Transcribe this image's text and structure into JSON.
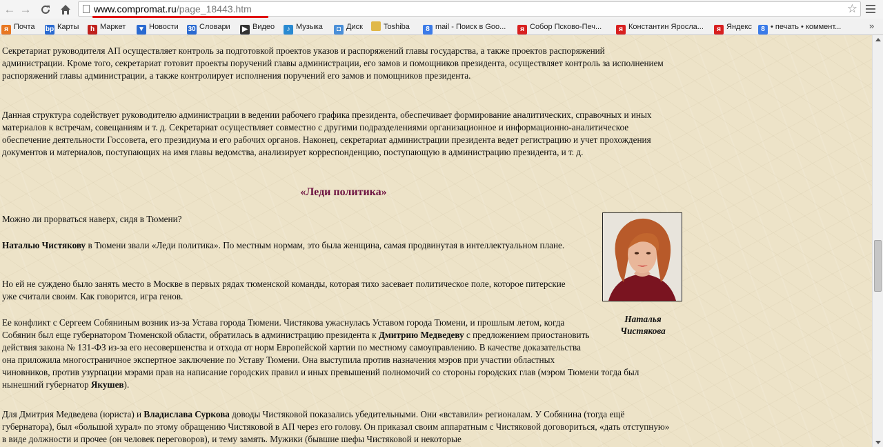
{
  "browser": {
    "url_host": "www.compromat.ru",
    "url_path": "/page_18443.htm",
    "icons": [
      "back-arrow-icon",
      "forward-arrow-icon",
      "reload-icon",
      "home-icon",
      "page-icon",
      "bookmark-star-icon",
      "menu-icon"
    ]
  },
  "bookmarks": [
    {
      "label": "Почта",
      "icon": "mail-icon",
      "color": "#e87722",
      "glyph": "я"
    },
    {
      "label": "Карты",
      "icon": "maps-icon",
      "color": "#2a6ad1",
      "glyph": "bp"
    },
    {
      "label": "Маркет",
      "icon": "market-icon",
      "color": "#c0201c",
      "glyph": "h"
    },
    {
      "label": "Новости",
      "icon": "news-icon",
      "color": "#2a6ad1",
      "glyph": "▼"
    },
    {
      "label": "Словари",
      "icon": "dictionary-icon",
      "color": "#2a6ad1",
      "glyph": "30"
    },
    {
      "label": "Видео",
      "icon": "video-icon",
      "color": "#333333",
      "glyph": "▶"
    },
    {
      "label": "Музыка",
      "icon": "music-icon",
      "color": "#2a8ad1",
      "glyph": "♪"
    },
    {
      "label": "Диск",
      "icon": "disk-icon",
      "color": "#4a8fd8",
      "glyph": "◘"
    },
    {
      "label": "Toshiba",
      "icon": "folder-icon",
      "color": "#e0b84a",
      "glyph": ""
    },
    {
      "label": "mail - Поиск в Goo...",
      "icon": "google-icon",
      "color": "#3b7be8",
      "glyph": "8"
    },
    {
      "label": "Собор Псково-Печ...",
      "icon": "yandex-icon",
      "color": "#d82020",
      "glyph": "я"
    },
    {
      "label": "Константин Яросла...",
      "icon": "yandex-icon",
      "color": "#d82020",
      "glyph": "я"
    },
    {
      "label": "Яндекс",
      "icon": "yandex-icon",
      "color": "#d82020",
      "glyph": "я"
    },
    {
      "label": "• печать • коммент...",
      "icon": "google-icon",
      "color": "#3b7be8",
      "glyph": "8"
    }
  ],
  "bookmarks_more": "»",
  "article": {
    "p1": "Секретариат руководителя АП осуществляет контроль за подготовкой проектов указов и распоряжений главы государства, а также проектов распоряжений администрации. Кроме того, секретариат готовит проекты поручений главы администрации, его замов и помощников президента, осуществляет контроль за исполнением распоряжений главы администрации, а также контролирует исполнения поручений его замов и помощников президента.",
    "p2": "Данная структура содействует руководителю администрации в ведении рабочего графика президента, обеспечивает формирование аналитических, справочных и иных материалов к встречам, совещаниям и т. д. Секретариат осуществляет совместно с другими подразделениями организационное и информационно-аналитическое обеспечение деятельности Госсовета, его президиума и его рабочих органов. Наконец, секретариат администрации президента ведет регистрацию и учет прохождения документов и материалов, поступающих на имя главы ведомства, анализирует корреспонденцию, поступающую в администрацию президента, и т. д.",
    "heading": "«Леди политика»",
    "p3": "Можно ли прорваться наверх, сидя в Тюмени?",
    "p4_bold": "Наталью Чистякову",
    "p4_rest": " в Тюмени звали «Леди политика». По местным нормам, это была женщина, самая продвинутая в интеллектуальном плане.",
    "p5": "Но ей не суждено было занять место в Москве в первых рядах тюменской команды, которая тихо засевает политическое поле, которое питерские уже считали своим. Как говорится, игра генов.",
    "p6_a": "Ее конфликт с Сергеем Собяниным возник из-за Устава города Тюмени. Чистякова ужаснулась Уставом города Тюмени, и прошлым летом, когда Собянин был еще губернатором Тюменской области, обратилась в администрацию президента к ",
    "p6_bold1": "Дмитрию Медведеву",
    "p6_b": " с предложением приостановить действия закона № 131-ФЗ из-за его несовершенства и отхода от норм Европейской хартии по местному самоуправлению. В качестве доказательства она приложила многостраничное экспертное заключение по Уставу Тюмени. Она выступила против назначения мэров при участии областных чиновников, против узурпации мэрами прав на написание городских правил и иных превышений полномочий со стороны городских глав (мэром Тюмени тогда был нынешний губернатор ",
    "p6_bold2": "Якушев",
    "p6_c": ").",
    "p7_a": "Для Дмитрия Медведева (юриста) и ",
    "p7_bold": "Владислава Суркова",
    "p7_b": " доводы Чистяковой показались убедительными. Они «вставили» регионалам. У Собянина (тогда ещё губернатора), был «большой хурал» по этому обращению Чистяковой в АП через его голову. Он приказал своим аппаратным с Чистяковой договориться, «дать отступную» в виде должности и прочее (он человек переговоров), и тему замять. Мужики (бывшие шефы Чистяковой и некоторые",
    "photo_caption": "Наталья Чистякова"
  },
  "colors": {
    "heading": "#6b1040",
    "background": "#ede3c8",
    "url_underline": "#e01010"
  }
}
